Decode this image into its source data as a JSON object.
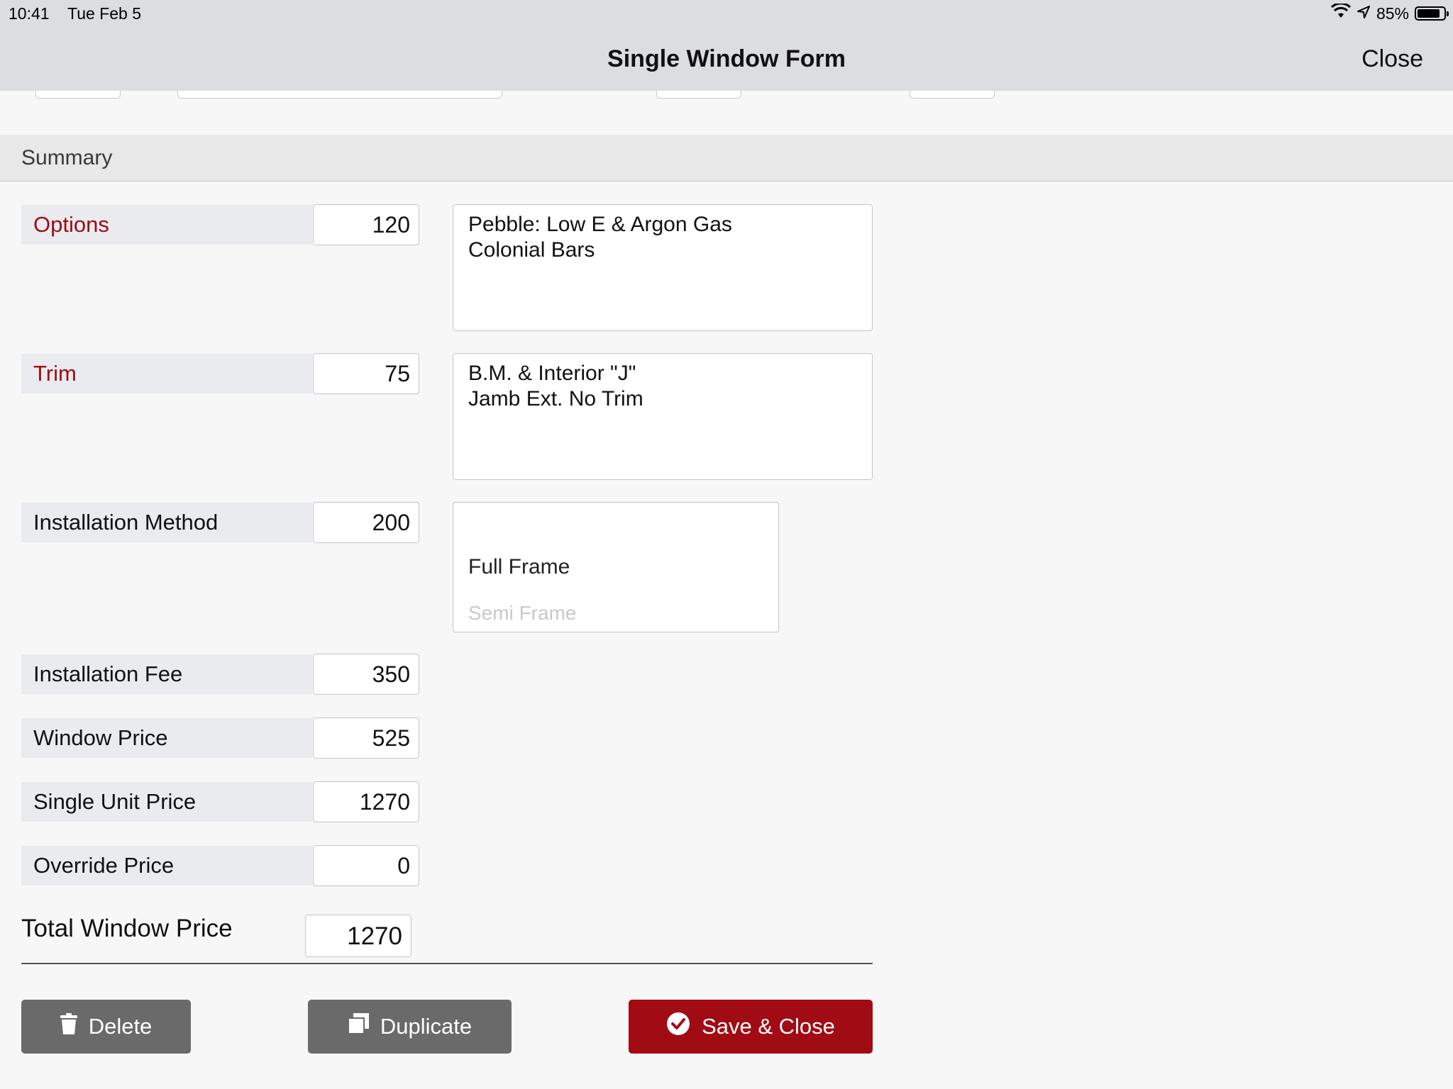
{
  "status_bar": {
    "time": "10:41",
    "date": "Tue Feb 5",
    "battery": "85%",
    "battery_level": 0.85
  },
  "nav": {
    "title": "Single Window Form",
    "close_label": "Close"
  },
  "section": {
    "title": "Summary"
  },
  "rows": {
    "options": {
      "label": "Options",
      "value": "120",
      "description": "Pebble: Low E & Argon Gas\nColonial Bars"
    },
    "trim": {
      "label": "Trim",
      "value": "75",
      "description": "B.M. & Interior \"J\"\nJamb Ext. No Trim"
    },
    "installation_method": {
      "label": "Installation Method",
      "value": "200",
      "selected": "Full Frame",
      "next_option": "Semi Frame"
    },
    "installation_fee": {
      "label": "Installation Fee",
      "value": "350"
    },
    "window_price": {
      "label": "Window Price",
      "value": "525"
    },
    "single_unit_price": {
      "label": "Single Unit Price",
      "value": "1270"
    },
    "override_price": {
      "label": "Override Price",
      "value": "0"
    }
  },
  "total": {
    "label": "Total Window Price",
    "value": "1270"
  },
  "buttons": {
    "delete": "Delete",
    "duplicate": "Duplicate",
    "save_close": "Save & Close"
  },
  "colors": {
    "accent_red": "#a10b14",
    "button_gray": "#6a6a6a",
    "bar_gray": "#dcdde1"
  }
}
